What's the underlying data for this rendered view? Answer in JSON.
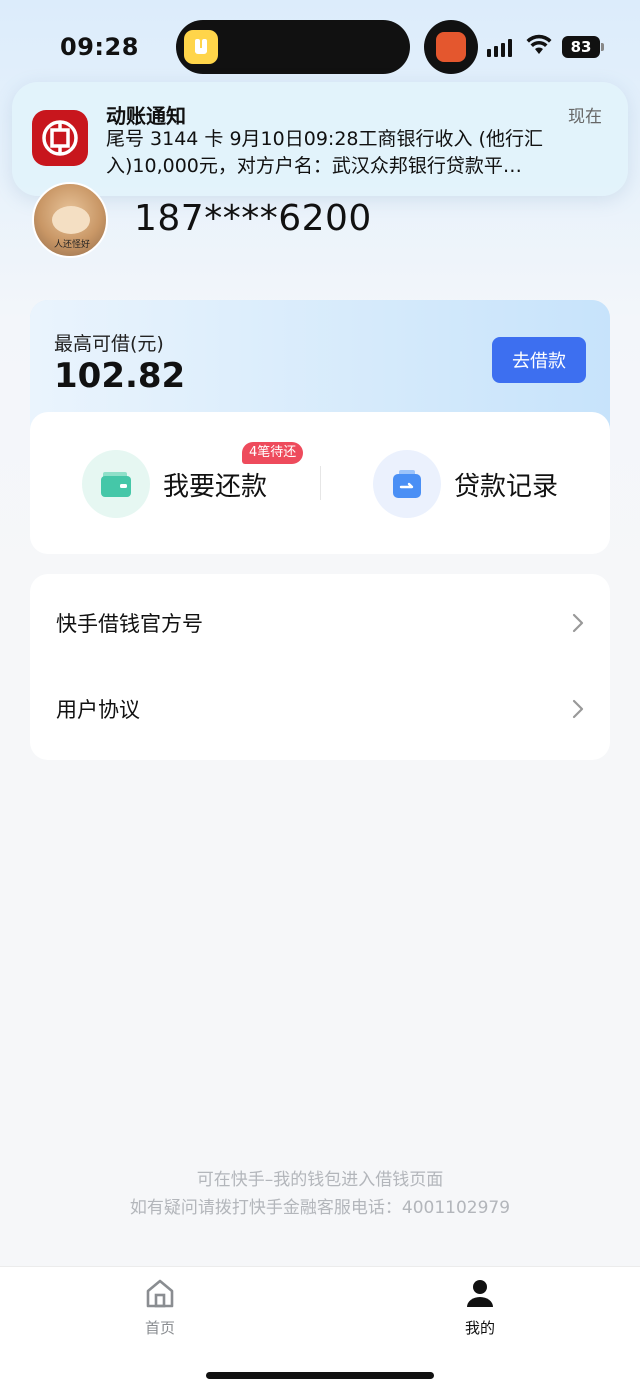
{
  "status_bar": {
    "time": "09:28",
    "battery": "83"
  },
  "notification": {
    "title": "动账通知",
    "time": "现在",
    "body": "尾号 3144 卡 9月10日09:28工商银行收入 (他行汇入)10,000元，对方户名：武汉众邦银行贷款平…",
    "icon": "icbc-bank-icon"
  },
  "profile": {
    "phone": "187****6200",
    "avatar_caption": "人还怪好"
  },
  "loan": {
    "label": "最高可借(元)",
    "amount": "102.82",
    "borrow_button": "去借款",
    "repay_label": "我要还款",
    "repay_badge": "4笔待还",
    "records_label": "贷款记录",
    "colors": {
      "button": "#3d6ff0",
      "badge": "#ee4b5c",
      "repay_icon": "#45c7a8",
      "records_icon": "#4a8ff5"
    }
  },
  "menu": {
    "items": [
      {
        "label": "快手借钱官方号"
      },
      {
        "label": "用户协议"
      }
    ]
  },
  "footer": {
    "line1": "可在快手–我的钱包进入借钱页面",
    "line2": "如有疑问请拨打快手金融客服电话：4001102979"
  },
  "tab_bar": {
    "tabs": [
      {
        "label": "首页",
        "icon": "home-icon",
        "active": false
      },
      {
        "label": "我的",
        "icon": "user-icon",
        "active": true
      }
    ]
  }
}
